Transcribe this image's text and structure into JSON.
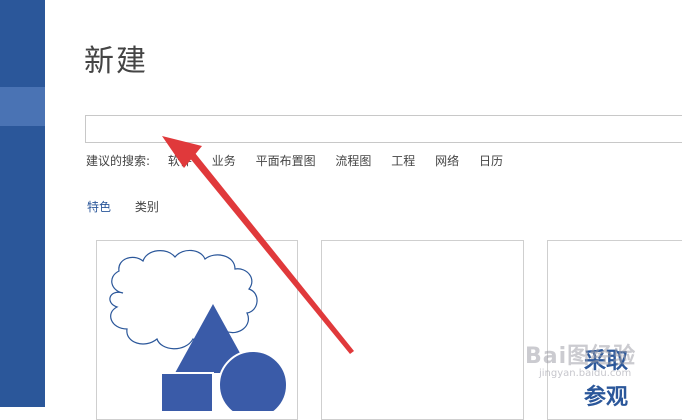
{
  "page": {
    "title": "新建"
  },
  "search": {
    "value": "",
    "placeholder": ""
  },
  "suggestions": {
    "label": "建议的搜索:",
    "items": [
      "软件",
      "业务",
      "平面布置图",
      "流程图",
      "工程",
      "网络",
      "日历"
    ]
  },
  "tabs": [
    "特色",
    "类别"
  ],
  "templates": [
    {
      "label": ""
    },
    {
      "label": ""
    },
    {
      "label_lines": [
        "采取",
        "参观"
      ]
    }
  ],
  "watermark": {
    "logo": "Bai图经验",
    "sub": "jingyan.baidu.com"
  },
  "colors": {
    "accent": "#2b579a",
    "sidebar": "#2b579a",
    "arrow": "#e0393b"
  }
}
